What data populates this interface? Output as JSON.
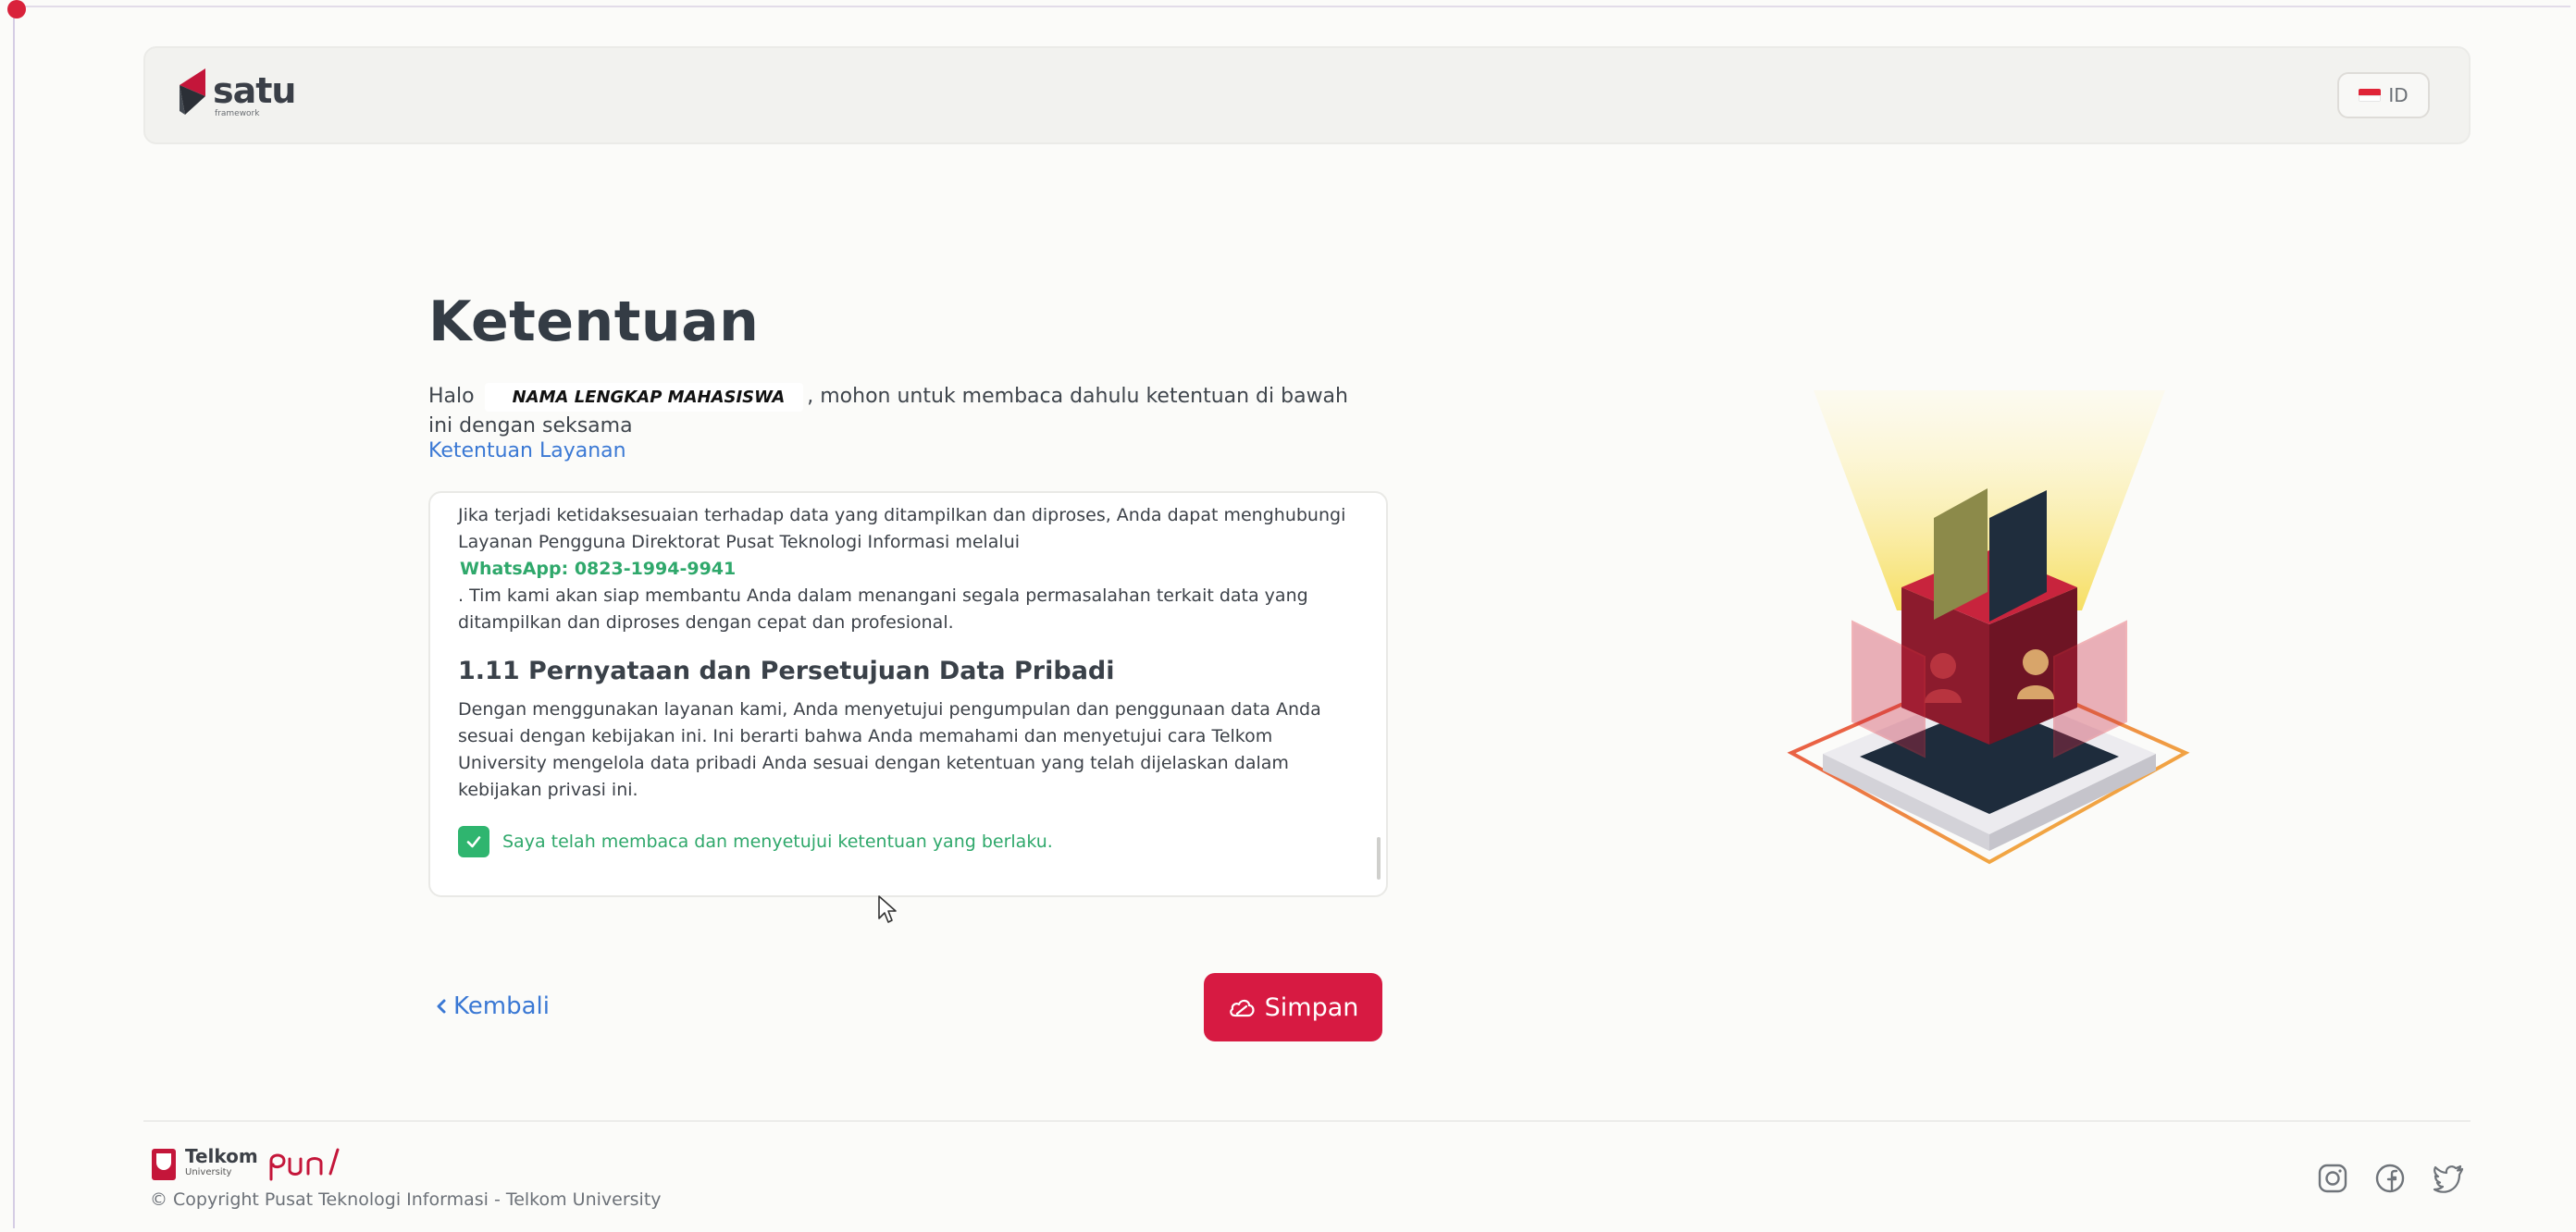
{
  "header": {
    "logo_word": "satu",
    "logo_sub": "framework",
    "language": "ID"
  },
  "main": {
    "title": "Ketentuan",
    "intro_prefix": "Halo",
    "student_name": "NAMA LENGKAP MAHASISWA",
    "intro_suffix": ", mohon untuk membaca dahulu ketentuan di bawah ini dengan seksama",
    "terms_link": "Ketentuan Layanan",
    "terms": {
      "contact_text": "Jika terjadi ketidaksesuaian terhadap data yang ditampilkan dan diproses, Anda dapat menghubungi Layanan Pengguna Direktorat Pusat Teknologi Informasi melalui",
      "whatsapp": "WhatsApp: 0823-1994-9941",
      "contact_followup": ". Tim kami akan siap membantu Anda dalam menangani segala permasalahan terkait data yang ditampilkan dan diproses dengan cepat dan profesional.",
      "section_title": "1.11 Pernyataan dan Persetujuan Data Pribadi",
      "section_body": "Dengan menggunakan layanan kami, Anda menyetujui pengumpulan dan penggunaan data Anda sesuai dengan kebijakan ini. Ini berarti bahwa Anda memahami dan menyetujui cara Telkom University mengelola data pribadi Anda sesuai dengan ketentuan yang telah dijelaskan dalam kebijakan privasi ini.",
      "consent_label": "Saya telah membaca dan menyetujui ketentuan yang berlaku.",
      "consent_checked": true
    },
    "back_label": "Kembali",
    "save_label": "Simpan"
  },
  "footer": {
    "telkom_name": "Telkom",
    "telkom_sub": "University",
    "brand_script": "puni",
    "copyright": "© Copyright Pusat Teknologi Informasi - Telkom University",
    "social_icons": [
      "instagram-icon",
      "facebook-icon",
      "twitter-icon"
    ]
  },
  "colors": {
    "primary_red": "#d71a42",
    "link_blue": "#3a78d4",
    "success_green": "#2fa86b"
  }
}
